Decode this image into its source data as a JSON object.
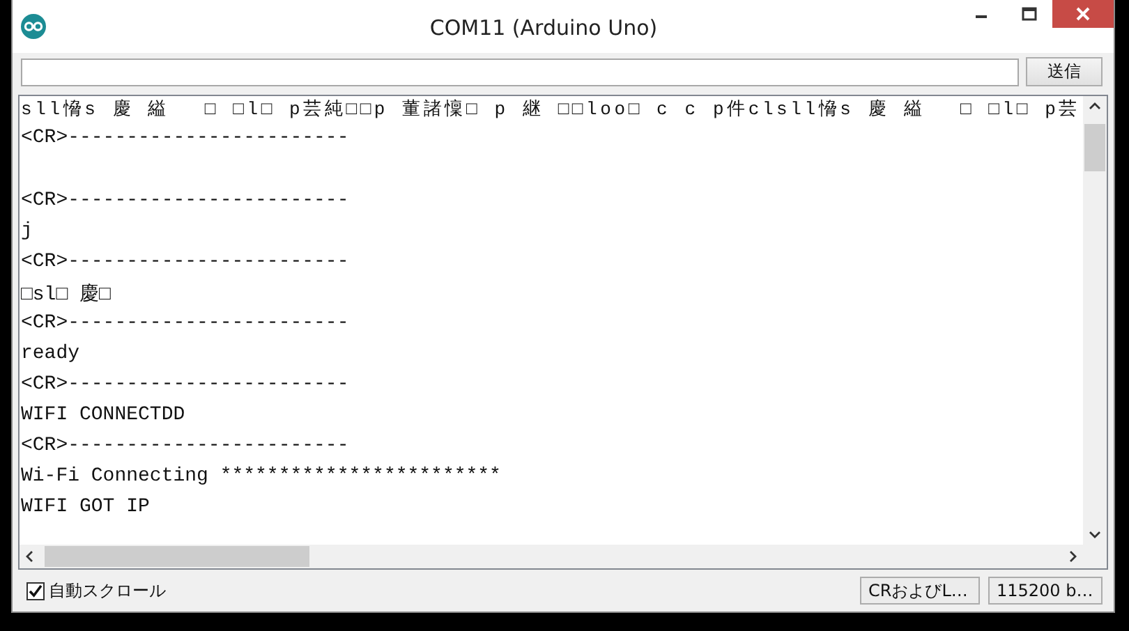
{
  "window": {
    "title": "COM11 (Arduino Uno)"
  },
  "send_button": "送信",
  "output": {
    "lines": [
      {
        "text": "sll愶s 慶 縊　 □ □l□ p芸純□□p 董諸懍□ p 継 □□loo□ c c p件clsll愶s 慶 縊　 □ □l□ p芸",
        "blank_before": false
      },
      {
        "text": "<CR>------------------------",
        "blank_before": false
      },
      {
        "text": "<CR>------------------------",
        "blank_before": true
      },
      {
        "text": "j",
        "blank_before": false
      },
      {
        "text": "<CR>------------------------",
        "blank_before": false
      },
      {
        "text": "□sl□ 慶□",
        "blank_before": false
      },
      {
        "text": "<CR>------------------------",
        "blank_before": false
      },
      {
        "text": "ready",
        "blank_before": false
      },
      {
        "text": "<CR>------------------------",
        "blank_before": false
      },
      {
        "text": "WIFI CONNECTDD",
        "blank_before": false
      },
      {
        "text": "<CR>------------------------",
        "blank_before": false
      },
      {
        "text": "Wi-Fi Connecting ************************",
        "blank_before": false
      },
      {
        "text": "WIFI GOT IP",
        "blank_before": false
      }
    ]
  },
  "autoscroll": {
    "label": "自動スクロール",
    "checked": true
  },
  "line_ending": {
    "value": "CRおよびL…"
  },
  "baud_rate": {
    "value": "115200 b…"
  }
}
